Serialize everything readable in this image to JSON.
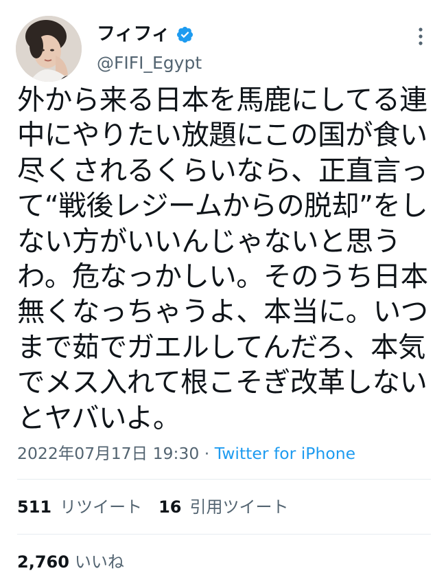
{
  "user": {
    "display_name": "フィフィ",
    "handle": "@FIFI_Egypt",
    "avatar_icon": "profile-photo",
    "verified_icon": "verified-badge-icon",
    "verified_color": "#1d9bf0"
  },
  "tweet": {
    "lines": [
      "外から来る日本を馬鹿にしてる連",
      "中にやりたい放題にこの国が食い",
      "尽くされるくらいなら、正直言っ",
      "て“戦後レジームからの脱却”をし",
      "ない方がいいんじゃないと思う",
      "わ。危なっかしい。そのうち日本",
      "無くなっちゃうよ、本当に。いつ",
      "まで茹でガエルしてんだろ、本気",
      "でメス入れて根こそぎ改革しない",
      "とヤバいよ。"
    ]
  },
  "meta": {
    "timestamp": "2022年07月17日 19:30",
    "separator": " · ",
    "source": "Twitter for iPhone"
  },
  "stats": {
    "retweets_count": "511",
    "retweets_label": "リツイート",
    "quotes_count": "16",
    "quotes_label": "引用ツイート",
    "likes_count": "2,760",
    "likes_label": "いいね"
  },
  "colors": {
    "text": "#0f1419",
    "secondary": "#536471",
    "link": "#1d9bf0",
    "divider": "#e6ecf0"
  }
}
